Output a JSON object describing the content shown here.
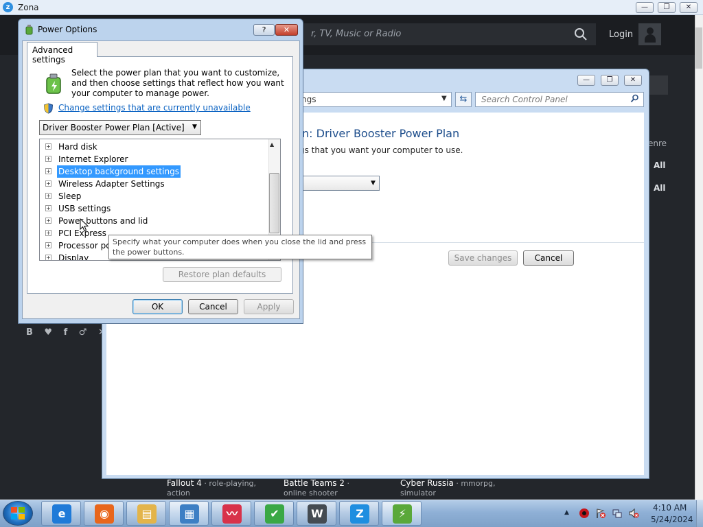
{
  "zona": {
    "title": "Zona",
    "logo_letter": "z",
    "search_placeholder": "r, TV, Music or Radio",
    "login": "Login",
    "genre": "enre",
    "all_1": "All",
    "all_2": "All",
    "social": "B ♥ f ♂ ✕",
    "controls": {
      "minimize": "—",
      "maximize": "❐",
      "close": "✕"
    },
    "games": [
      {
        "title": "Fallout 4",
        "sub": " · role-playing,",
        "sub2": "action"
      },
      {
        "title": "Battle Teams 2",
        "sub": " ·",
        "sub2": "online shooter"
      },
      {
        "title": "Cyber Russia",
        "sub": " · mmorpg,",
        "sub2": "simulator"
      }
    ]
  },
  "control_panel": {
    "address": "ngs",
    "search_placeholder": "Search Control Panel",
    "heading": "n: Driver Booster Power Plan",
    "subtext": "gs that you want your computer to use.",
    "save_button": "Save changes",
    "cancel_button": "Cancel",
    "controls": {
      "minimize": "—",
      "maximize": "❐",
      "close": "✕"
    }
  },
  "power_options": {
    "title": "Power Options",
    "help_button": "?",
    "close_button": "✕",
    "tab": "Advanced settings",
    "intro": "Select the power plan that you want to customize, and then choose settings that reflect how you want your computer to manage power.",
    "change_link": "Change settings that are currently unavailable",
    "plan_selected": "Driver Booster Power Plan [Active]",
    "tree_items": [
      {
        "label": "Hard disk",
        "selected": false
      },
      {
        "label": "Internet Explorer",
        "selected": false
      },
      {
        "label": "Desktop background settings",
        "selected": true
      },
      {
        "label": "Wireless Adapter Settings",
        "selected": false
      },
      {
        "label": "Sleep",
        "selected": false
      },
      {
        "label": "USB settings",
        "selected": false
      },
      {
        "label": "Power buttons and lid",
        "selected": false
      },
      {
        "label": "PCI Express",
        "selected": false
      },
      {
        "label": "Processor pow",
        "selected": false
      },
      {
        "label": "Display",
        "selected": false
      }
    ],
    "restore_button": "Restore plan defaults",
    "ok_button": "OK",
    "cancel_button": "Cancel",
    "apply_button": "Apply"
  },
  "tooltip": {
    "text": "Specify what your computer does when you close the lid and press the power buttons."
  },
  "taskbar": {
    "apps": [
      {
        "name": "internet-explorer",
        "glyph": "e",
        "color": "#1f7ad8"
      },
      {
        "name": "firefox",
        "glyph": "◉",
        "color": "#e8661c"
      },
      {
        "name": "file-explorer",
        "glyph": "▤",
        "color": "#e3b44a"
      },
      {
        "name": "control-panel",
        "glyph": "▦",
        "color": "#3d7fc4"
      },
      {
        "name": "zona-wave",
        "glyph": "〰",
        "color": "#d8324a"
      },
      {
        "name": "shield",
        "glyph": "✔",
        "color": "#3aa845"
      },
      {
        "name": "world-of-tanks",
        "glyph": "W",
        "color": "#444b52"
      },
      {
        "name": "zona",
        "glyph": "Z",
        "color": "#1e8ee0"
      },
      {
        "name": "power-options",
        "glyph": "⚡",
        "color": "#5aa83a"
      }
    ],
    "time": "4:10 AM",
    "date": "5/24/2024"
  }
}
